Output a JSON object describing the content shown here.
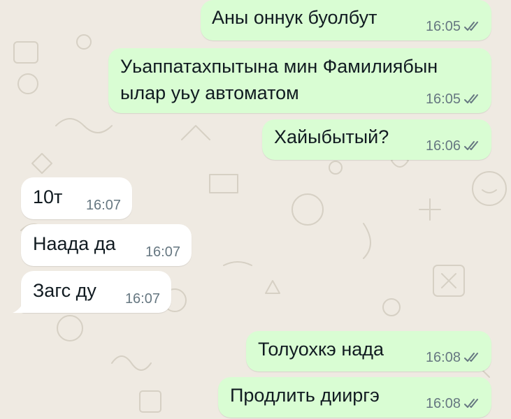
{
  "chat": {
    "messages": [
      {
        "direction": "out",
        "text": "Аны оннук буолбут",
        "time": "16:05",
        "status": "read-double-check"
      },
      {
        "direction": "out",
        "text_lines": [
          "Уьаппатахпытына мин Фамилиябын",
          "ылар уьу автоматом"
        ],
        "time": "16:05",
        "status": "read-double-check"
      },
      {
        "direction": "out",
        "text": "Хайыбытый?",
        "time": "16:06",
        "status": "read-double-check"
      },
      {
        "direction": "in",
        "text": "10т",
        "time": "16:07"
      },
      {
        "direction": "in",
        "text": "Наада да",
        "time": "16:07"
      },
      {
        "direction": "in",
        "text": "Загс ду",
        "time": "16:07"
      },
      {
        "direction": "out",
        "text": "Толуохкэ нада",
        "time": "16:08",
        "status": "read-double-check"
      },
      {
        "direction": "out",
        "text": "Продлить дииргэ",
        "time": "16:08",
        "status": "read-double-check"
      }
    ]
  },
  "colors": {
    "background": "#efeae2",
    "outgoing_bubble": "#d9fdd3",
    "incoming_bubble": "#ffffff",
    "text": "#111b21",
    "timestamp": "#667781",
    "tick": "#667781"
  },
  "icons": {
    "status_icon": "double-check-icon",
    "wallpaper": "doodle-pattern"
  }
}
